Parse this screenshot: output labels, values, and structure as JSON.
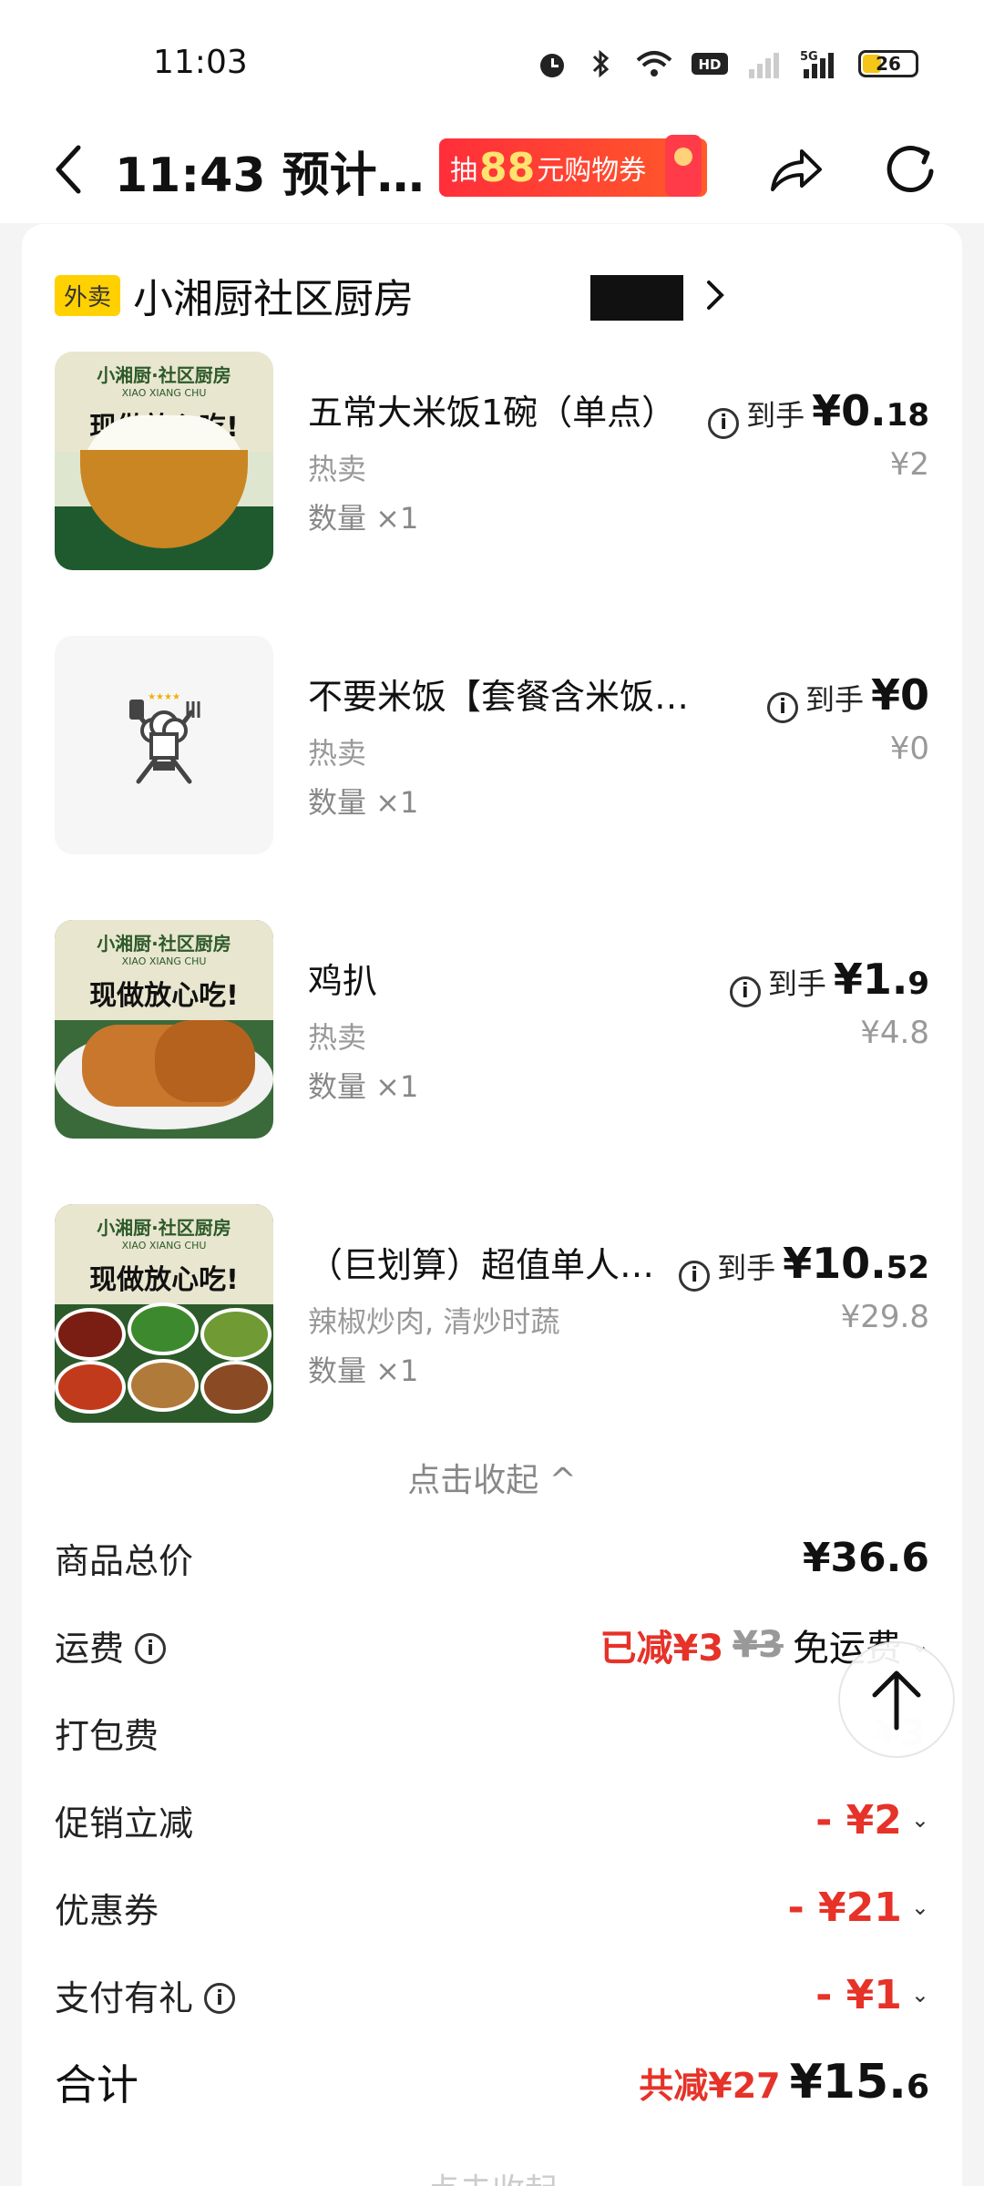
{
  "status": {
    "time": "11:03",
    "battery": "26",
    "icons": [
      "alarm-icon",
      "bluetooth-icon",
      "wifi-icon",
      "hd-icon",
      "signal-icon",
      "5g-signal-icon",
      "battery-icon"
    ]
  },
  "nav": {
    "title": "11:43 预计…",
    "promo_prefix": "抽",
    "promo_amount": "88",
    "promo_suffix": "元购物券",
    "icons": [
      "back-icon",
      "share-icon",
      "refresh-icon"
    ]
  },
  "shop": {
    "tag": "外卖",
    "name": "小湘厨社区厨房"
  },
  "image_text": {
    "brand": "小湘厨·社区厨房",
    "brand_sub": "XIAO XIANG CHU",
    "slogan": "现做放心吃!"
  },
  "items": [
    {
      "name": "五常大米饭1碗（单点）",
      "tag": "热卖",
      "qty": "数量 ×1",
      "daoshou": "到手",
      "price_int": "¥0.",
      "price_dec": "18",
      "orig": "¥2"
    },
    {
      "name": "不要米饭【套餐含米饭…",
      "tag": "热卖",
      "qty": "数量 ×1",
      "daoshou": "到手",
      "price_int": "¥0",
      "price_dec": "",
      "orig": "¥0"
    },
    {
      "name": "鸡扒",
      "tag": "热卖",
      "qty": "数量 ×1",
      "daoshou": "到手",
      "price_int": "¥1.",
      "price_dec": "9",
      "orig": "¥4.8"
    },
    {
      "name": "（巨划算）超值单人…",
      "tag": "辣椒炒肉, 清炒时蔬",
      "qty": "数量 ×1",
      "daoshou": "到手",
      "price_int": "¥10.",
      "price_dec": "52",
      "orig": "¥29.8"
    }
  ],
  "collapse_label": "点击收起 ^",
  "summary": {
    "goods_total_label": "商品总价",
    "goods_total": "¥36.6",
    "delivery_label": "运费",
    "delivery_reduced": "已减¥3",
    "delivery_orig": "¥3",
    "delivery_free": "免运费",
    "packing_label": "打包费",
    "promo_label": "促销立减",
    "promo_value": "- ¥2",
    "coupon_label": "优惠券",
    "coupon_value": "- ¥21",
    "pay_gift_label": "支付有礼",
    "pay_gift_value": "- ¥1",
    "total_label": "合计",
    "total_saved": "共减¥27",
    "total_int": "¥15.",
    "total_dec": "6"
  },
  "ghost_value": "¥3",
  "bottom_text": "点击收起"
}
